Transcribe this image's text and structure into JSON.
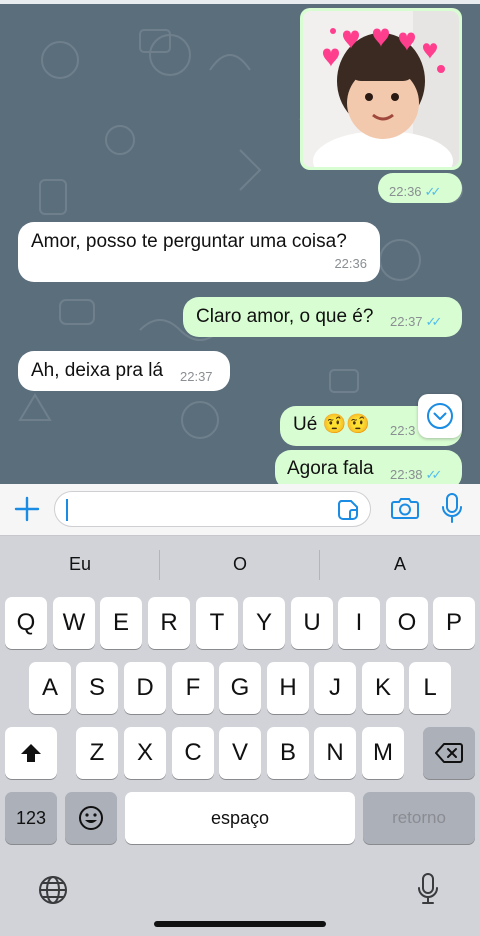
{
  "chat": {
    "photo_message": {
      "time": "22:36",
      "read": "✓✓"
    },
    "messages": [
      {
        "direction": "in",
        "text": "Amor, posso te perguntar uma coisa?",
        "time": "22:36"
      },
      {
        "direction": "out",
        "text": "Claro amor, o que é?",
        "time": "22:37",
        "read": "✓✓"
      },
      {
        "direction": "in",
        "text": "Ah, deixa pra lá",
        "time": "22:37"
      },
      {
        "direction": "out",
        "text": "Ué 🤨🤨",
        "time": "22:37",
        "time_visible": "22:3",
        "read": ""
      },
      {
        "direction": "out",
        "text": "Agora fala",
        "time": "22:38",
        "read": "✓✓"
      }
    ],
    "scroll_down_icon": "chevron-down-circle-icon"
  },
  "input_bar": {
    "attach_icon": "plus-icon",
    "message_value": "",
    "sticker_icon": "sticker-icon",
    "camera_icon": "camera-icon",
    "mic_icon": "microphone-icon"
  },
  "keyboard": {
    "suggestions": [
      "Eu",
      "O",
      "A"
    ],
    "row1": [
      "Q",
      "W",
      "E",
      "R",
      "T",
      "Y",
      "U",
      "I",
      "O",
      "P"
    ],
    "row2": [
      "A",
      "S",
      "D",
      "F",
      "G",
      "H",
      "J",
      "K",
      "L"
    ],
    "row3": [
      "Z",
      "X",
      "C",
      "V",
      "B",
      "N",
      "M"
    ],
    "numbers_key": "123",
    "space_key": "espaço",
    "return_key": "retorno",
    "shift_icon": "shift-icon",
    "backspace_icon": "backspace-icon",
    "emoji_icon": "emoji-icon",
    "globe_icon": "globe-icon",
    "dictation_icon": "microphone-icon"
  },
  "colors": {
    "chat_background": "#5b6e7c",
    "outgoing_bubble": "#d8fdd2",
    "incoming_bubble": "#ffffff",
    "accent": "#1a8ce3",
    "read_ticks": "#53bdeb",
    "keyboard_background": "#d1d3d9"
  }
}
